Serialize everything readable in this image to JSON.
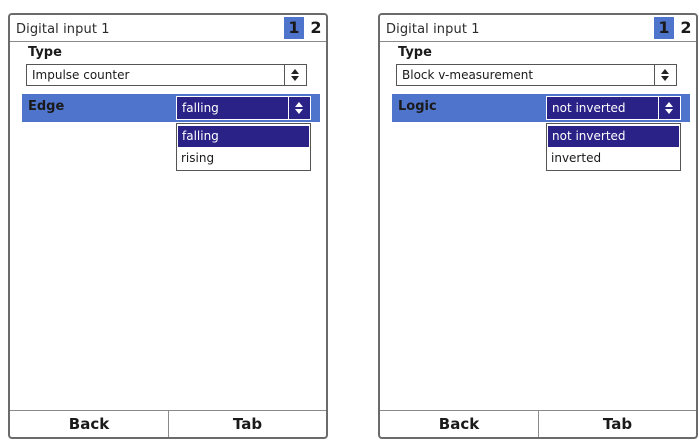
{
  "screens": [
    {
      "title": "Digital input 1",
      "pages": [
        "1",
        "2"
      ],
      "active_page": "1",
      "type_label": "Type",
      "type_value": "Impulse counter",
      "field_label": "Edge",
      "field_value": "falling",
      "options": [
        "falling",
        "rising"
      ],
      "buttons": {
        "back": "Back",
        "tab": "Tab"
      }
    },
    {
      "title": "Digital input 1",
      "pages": [
        "1",
        "2"
      ],
      "active_page": "1",
      "type_label": "Type",
      "type_value": "Block v-measurement",
      "field_label": "Logic",
      "field_value": "not inverted",
      "options": [
        "not inverted",
        "inverted"
      ],
      "buttons": {
        "back": "Back",
        "tab": "Tab"
      }
    }
  ],
  "colors": {
    "accent": "#4f74cc",
    "selection": "#2a2286",
    "border": "#555555"
  },
  "icons": {
    "select_arrow": "updown-arrows-icon"
  }
}
